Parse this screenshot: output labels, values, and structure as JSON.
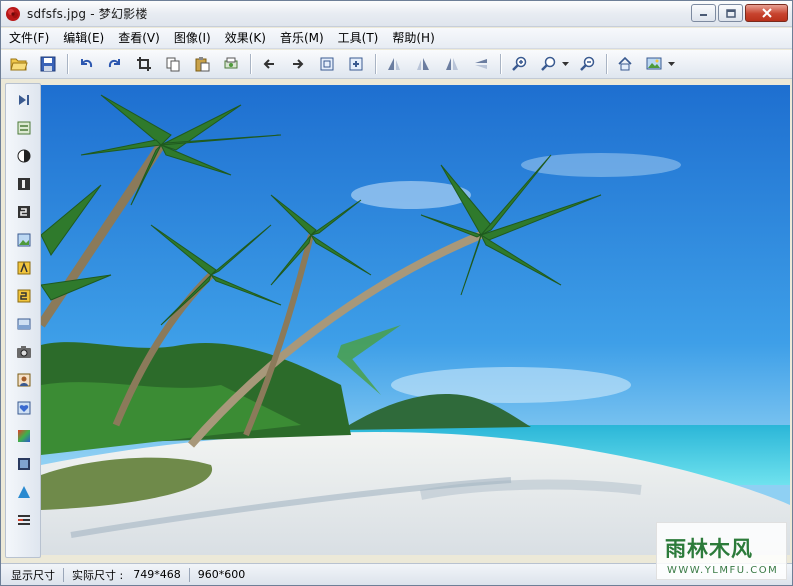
{
  "window": {
    "title": "sdfsfs.jpg - 梦幻影楼",
    "app_icon": "red-rose-icon",
    "controls": [
      "minimize-icon",
      "maximize-icon",
      "close-icon"
    ]
  },
  "menu": {
    "items": [
      {
        "label": "文件(F)"
      },
      {
        "label": "编辑(E)"
      },
      {
        "label": "查看(V)"
      },
      {
        "label": "图像(I)"
      },
      {
        "label": "效果(K)"
      },
      {
        "label": "音乐(M)"
      },
      {
        "label": "工具(T)"
      },
      {
        "label": "帮助(H)"
      }
    ]
  },
  "toolbar": {
    "icons": [
      "open-folder-icon",
      "save-icon",
      "undo-icon",
      "redo-icon",
      "crop-icon",
      "copy-icon",
      "paste-icon",
      "print-icon",
      "previous-image-icon",
      "next-image-icon",
      "fit-window-icon",
      "actual-size-icon",
      "rotate-left-icon",
      "rotate-right-icon",
      "flip-horizontal-icon",
      "flip-vertical-icon",
      "zoom-in-icon",
      "zoom-icon",
      "zoom-out-icon",
      "home-icon",
      "wallpaper-icon"
    ]
  },
  "sidebar": {
    "icons": [
      "play-slideshow-icon",
      "adjust-icon",
      "contrast-icon",
      "page-1-icon",
      "page-2-icon",
      "image-icon",
      "frame-a-icon",
      "frame-b-icon",
      "panel-icon",
      "camera-icon",
      "portrait-icon",
      "heart-frame-icon",
      "gradient-icon",
      "film-icon",
      "triangle-icon",
      "list-icon"
    ]
  },
  "status": {
    "display_size_label": "显示尺寸",
    "actual_size_label": "实际尺寸 :",
    "actual_size_value": "749*468",
    "screen_size_value": "960*600"
  },
  "watermark": {
    "text": "雨林木风",
    "url": "WWW.YLMFU.COM"
  },
  "colors": {
    "sky": "#2f8fe0",
    "sea": "#34c6e0",
    "sand": "#e9ecef",
    "palm": "#2f7a2c",
    "close_button": "#c7432e"
  }
}
